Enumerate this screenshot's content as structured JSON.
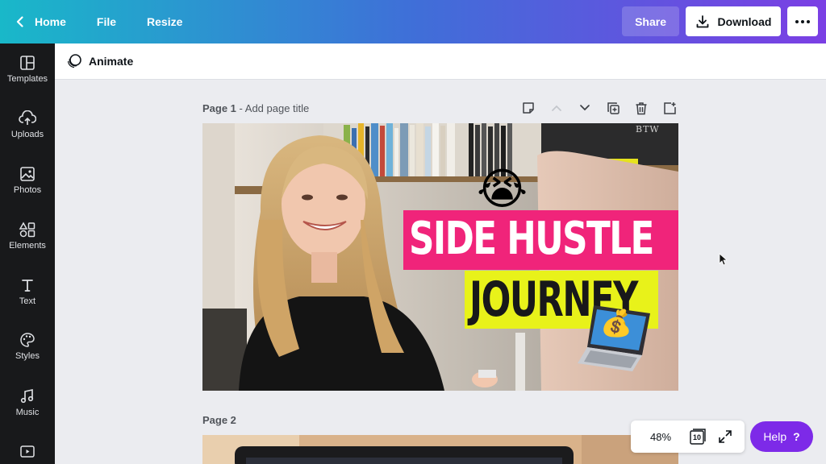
{
  "topbar": {
    "home_label": "Home",
    "file_label": "File",
    "resize_label": "Resize",
    "share_label": "Share",
    "download_label": "Download"
  },
  "sidebar": {
    "items": [
      {
        "label": "Templates",
        "icon": "templates-icon"
      },
      {
        "label": "Uploads",
        "icon": "upload-icon"
      },
      {
        "label": "Photos",
        "icon": "photo-icon"
      },
      {
        "label": "Elements",
        "icon": "elements-icon"
      },
      {
        "label": "Text",
        "icon": "text-icon"
      },
      {
        "label": "Styles",
        "icon": "palette-icon"
      },
      {
        "label": "Music",
        "icon": "music-icon"
      }
    ]
  },
  "subbar": {
    "animate_label": "Animate"
  },
  "pages": [
    {
      "label": "Page 1",
      "title_placeholder": "- Add page title"
    },
    {
      "label": "Page 2"
    }
  ],
  "design": {
    "headline_line1": "SIDE HUSTLE",
    "headline_line2": "JOURNEY",
    "shelf_sign": "BTW",
    "emoji_top": "😭",
    "emoji_bottom": "💰",
    "accent_pink": "#f0247a",
    "accent_yellow": "#e8f21a"
  },
  "footer": {
    "zoom": "48%",
    "page_count": "10",
    "help_label": "Help",
    "help_glyph": "?"
  },
  "colors": {
    "brand_purple": "#7d2ae8",
    "sidebar_bg": "#18191b"
  }
}
